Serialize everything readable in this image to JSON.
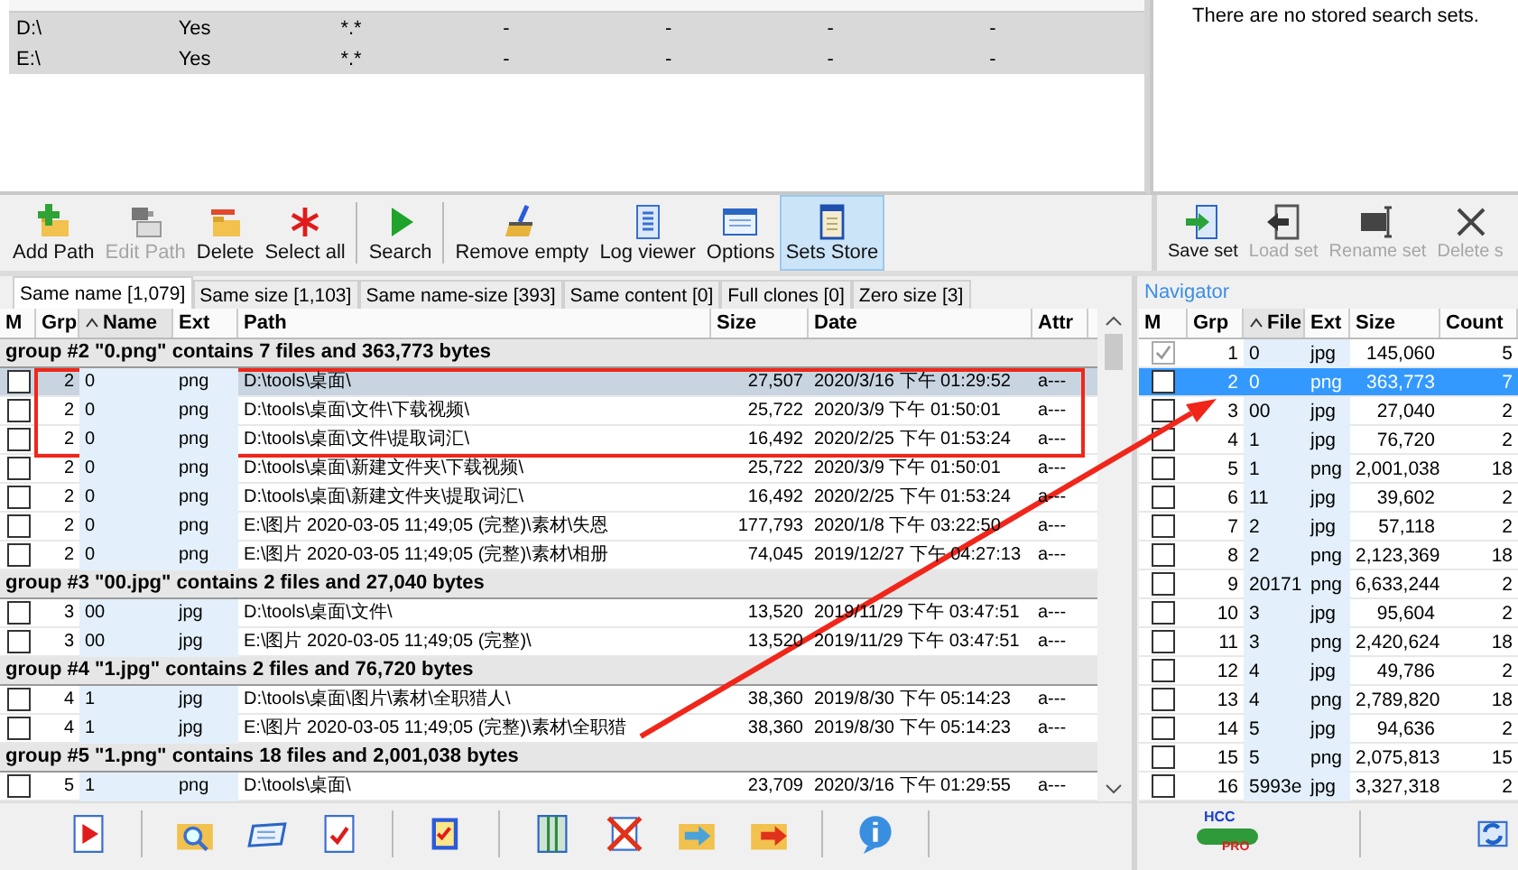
{
  "search_paths": {
    "rows": [
      {
        "cells": [
          "D:\\",
          "Yes",
          "*.*",
          "-",
          "-",
          "-",
          "-"
        ]
      },
      {
        "cells": [
          "E:\\",
          "Yes",
          "*.*",
          "-",
          "-",
          "-",
          "-"
        ]
      }
    ]
  },
  "sets_panel": {
    "message": "There are no stored search sets."
  },
  "toolbar": {
    "groups": [
      [
        {
          "label": "Add Path",
          "disabled": false,
          "selected": false
        },
        {
          "label": "Edit Path",
          "disabled": true,
          "selected": false
        },
        {
          "label": "Delete",
          "disabled": false,
          "selected": false
        },
        {
          "label": "Select all",
          "disabled": false,
          "selected": false
        }
      ],
      [
        {
          "label": "Search",
          "disabled": false,
          "selected": false
        }
      ],
      [
        {
          "label": "Remove empty",
          "disabled": false,
          "selected": false
        },
        {
          "label": "Log viewer",
          "disabled": false,
          "selected": false
        },
        {
          "label": "Options",
          "disabled": false,
          "selected": false
        },
        {
          "label": "Sets Store",
          "disabled": false,
          "selected": true
        }
      ]
    ]
  },
  "sets_toolbar": [
    {
      "label": "Save set",
      "disabled": false
    },
    {
      "label": "Load set",
      "disabled": true
    },
    {
      "label": "Rename set",
      "disabled": true
    },
    {
      "label": "Delete s",
      "disabled": true
    }
  ],
  "tabs": [
    {
      "label": "Same name [1,079]",
      "selected": true
    },
    {
      "label": "Same size [1,103]",
      "selected": false
    },
    {
      "label": "Same name-size [393]",
      "selected": false
    },
    {
      "label": "Same content [0]",
      "selected": false
    },
    {
      "label": "Full clones [0]",
      "selected": false
    },
    {
      "label": "Zero size [3]",
      "selected": false
    }
  ],
  "results": {
    "check_header": "M",
    "columns": [
      {
        "label": "Grp",
        "sorted": false,
        "highlighted": false
      },
      {
        "label": "Name",
        "sorted": true,
        "highlighted": true
      },
      {
        "label": "Ext",
        "sorted": false,
        "highlighted": true
      },
      {
        "label": "Path",
        "sorted": false,
        "highlighted": false
      },
      {
        "label": "Size",
        "sorted": false,
        "highlighted": false
      },
      {
        "label": "Date",
        "sorted": false,
        "highlighted": false
      },
      {
        "label": "Attr",
        "sorted": false,
        "highlighted": false
      }
    ],
    "groups": [
      {
        "title": "group #2 \"0.png\" contains 7 files and 363,773 bytes",
        "rows": [
          {
            "checked": false,
            "selected": true,
            "cells": [
              "2",
              "0",
              "png",
              "D:\\tools\\桌面\\",
              "27,507",
              "2020/3/16 下午 01:29:52",
              "a---"
            ]
          },
          {
            "checked": false,
            "selected": false,
            "cells": [
              "2",
              "0",
              "png",
              "D:\\tools\\桌面\\文件\\下载视频\\",
              "25,722",
              "2020/3/9 下午 01:50:01",
              "a---"
            ]
          },
          {
            "checked": false,
            "selected": false,
            "cells": [
              "2",
              "0",
              "png",
              "D:\\tools\\桌面\\文件\\提取词汇\\",
              "16,492",
              "2020/2/25 下午 01:53:24",
              "a---"
            ]
          },
          {
            "checked": false,
            "selected": false,
            "cells": [
              "2",
              "0",
              "png",
              "D:\\tools\\桌面\\新建文件夹\\下载视频\\",
              "25,722",
              "2020/3/9 下午 01:50:01",
              "a---"
            ]
          },
          {
            "checked": false,
            "selected": false,
            "cells": [
              "2",
              "0",
              "png",
              "D:\\tools\\桌面\\新建文件夹\\提取词汇\\",
              "16,492",
              "2020/2/25 下午 01:53:24",
              "a---"
            ]
          },
          {
            "checked": false,
            "selected": false,
            "cells": [
              "2",
              "0",
              "png",
              "E:\\图片 2020-03-05 11;49;05 (完整)\\素材\\失恩",
              "177,793",
              "2020/1/8 下午 03:22:50",
              "a---"
            ]
          },
          {
            "checked": false,
            "selected": false,
            "cells": [
              "2",
              "0",
              "png",
              "E:\\图片 2020-03-05 11;49;05 (完整)\\素材\\相册",
              "74,045",
              "2019/12/27 下午 04:27:13",
              "a---"
            ]
          }
        ]
      },
      {
        "title": "group #3 \"00.jpg\" contains 2 files and 27,040 bytes",
        "rows": [
          {
            "checked": false,
            "selected": false,
            "cells": [
              "3",
              "00",
              "jpg",
              "D:\\tools\\桌面\\文件\\",
              "13,520",
              "2019/11/29 下午 03:47:51",
              "a---"
            ]
          },
          {
            "checked": false,
            "selected": false,
            "cells": [
              "3",
              "00",
              "jpg",
              "E:\\图片 2020-03-05 11;49;05 (完整)\\",
              "13,520",
              "2019/11/29 下午 03:47:51",
              "a---"
            ]
          }
        ]
      },
      {
        "title": "group #4 \"1.jpg\" contains 2 files and 76,720 bytes",
        "rows": [
          {
            "checked": false,
            "selected": false,
            "cells": [
              "4",
              "1",
              "jpg",
              "D:\\tools\\桌面\\图片\\素材\\全职猎人\\",
              "38,360",
              "2019/8/30 下午 05:14:23",
              "a---"
            ]
          },
          {
            "checked": false,
            "selected": false,
            "cells": [
              "4",
              "1",
              "jpg",
              "E:\\图片 2020-03-05 11;49;05 (完整)\\素材\\全职猎",
              "38,360",
              "2019/8/30 下午 05:14:23",
              "a---"
            ]
          }
        ]
      },
      {
        "title": "group #5 \"1.png\" contains 18 files and 2,001,038 bytes",
        "rows": [
          {
            "checked": false,
            "selected": false,
            "cells": [
              "5",
              "1",
              "png",
              "D:\\tools\\桌面\\",
              "23,709",
              "2020/3/16 下午 01:29:55",
              "a---"
            ]
          }
        ]
      }
    ]
  },
  "navigator": {
    "title": "Navigator",
    "check_header": "M",
    "columns": [
      {
        "label": "Grp",
        "sorted": false,
        "highlighted": false
      },
      {
        "label": "File",
        "sorted": true,
        "highlighted": true
      },
      {
        "label": "Ext",
        "sorted": false,
        "highlighted": true
      },
      {
        "label": "Size",
        "sorted": false,
        "highlighted": false
      },
      {
        "label": "Count",
        "sorted": false,
        "highlighted": false
      }
    ],
    "rows": [
      {
        "checked": true,
        "selected": false,
        "cells": [
          "1",
          "0",
          "jpg",
          "145,060",
          "5"
        ]
      },
      {
        "checked": false,
        "selected": true,
        "cells": [
          "2",
          "0",
          "png",
          "363,773",
          "7"
        ]
      },
      {
        "checked": false,
        "selected": false,
        "cells": [
          "3",
          "00",
          "jpg",
          "27,040",
          "2"
        ]
      },
      {
        "checked": false,
        "selected": false,
        "cells": [
          "4",
          "1",
          "jpg",
          "76,720",
          "2"
        ]
      },
      {
        "checked": false,
        "selected": false,
        "cells": [
          "5",
          "1",
          "png",
          "2,001,038",
          "18"
        ]
      },
      {
        "checked": false,
        "selected": false,
        "cells": [
          "6",
          "11",
          "jpg",
          "39,602",
          "2"
        ]
      },
      {
        "checked": false,
        "selected": false,
        "cells": [
          "7",
          "2",
          "jpg",
          "57,118",
          "2"
        ]
      },
      {
        "checked": false,
        "selected": false,
        "cells": [
          "8",
          "2",
          "png",
          "2,123,369",
          "18"
        ]
      },
      {
        "checked": false,
        "selected": false,
        "cells": [
          "9",
          "20171",
          "png",
          "6,633,244",
          "2"
        ]
      },
      {
        "checked": false,
        "selected": false,
        "cells": [
          "10",
          "3",
          "jpg",
          "95,604",
          "2"
        ]
      },
      {
        "checked": false,
        "selected": false,
        "cells": [
          "11",
          "3",
          "png",
          "2,420,624",
          "18"
        ]
      },
      {
        "checked": false,
        "selected": false,
        "cells": [
          "12",
          "4",
          "jpg",
          "49,786",
          "2"
        ]
      },
      {
        "checked": false,
        "selected": false,
        "cells": [
          "13",
          "4",
          "png",
          "2,789,820",
          "18"
        ]
      },
      {
        "checked": false,
        "selected": false,
        "cells": [
          "14",
          "5",
          "jpg",
          "94,636",
          "2"
        ]
      },
      {
        "checked": false,
        "selected": false,
        "cells": [
          "15",
          "5",
          "png",
          "2,075,813",
          "15"
        ]
      },
      {
        "checked": false,
        "selected": false,
        "cells": [
          "16",
          "5993e",
          "jpg",
          "3,327,318",
          "2"
        ]
      }
    ]
  },
  "navigator_footer": {
    "logo_text": "HCC",
    "logo_badge": "PRO"
  }
}
